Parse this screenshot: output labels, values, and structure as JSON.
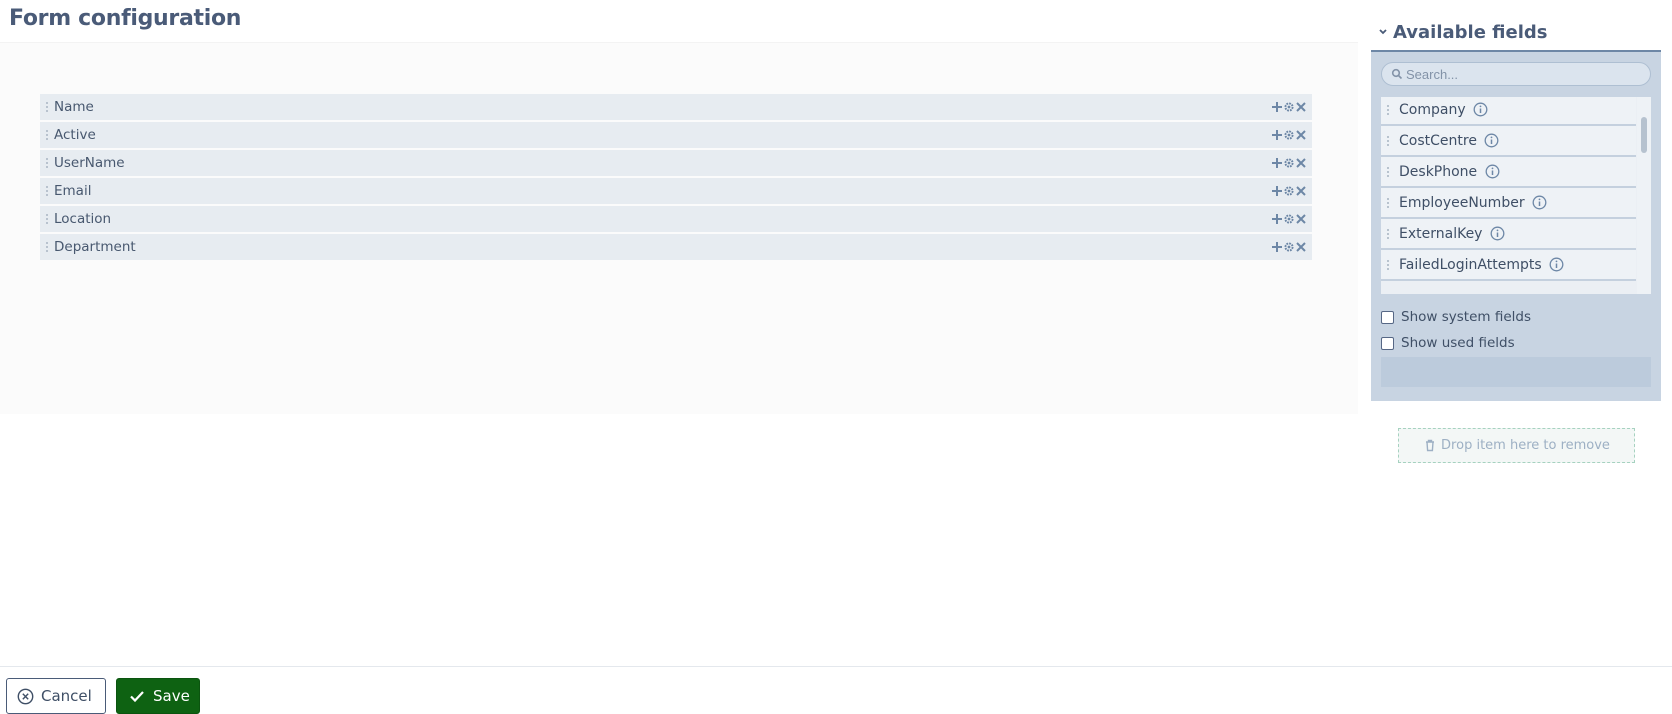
{
  "page": {
    "title": "Form configuration"
  },
  "form_fields": [
    {
      "label": "Name"
    },
    {
      "label": "Active"
    },
    {
      "label": "UserName"
    },
    {
      "label": "Email"
    },
    {
      "label": "Location"
    },
    {
      "label": "Department"
    }
  ],
  "available_panel": {
    "title": "Available fields",
    "search_placeholder": "Search...",
    "items": [
      {
        "label": "Company"
      },
      {
        "label": "CostCentre"
      },
      {
        "label": "DeskPhone"
      },
      {
        "label": "EmployeeNumber"
      },
      {
        "label": "ExternalKey"
      },
      {
        "label": "FailedLoginAttempts"
      }
    ],
    "show_system_fields_label": "Show system fields",
    "show_used_fields_label": "Show used fields"
  },
  "dropzone": {
    "label": "Drop item here to remove"
  },
  "footer": {
    "cancel_label": "Cancel",
    "save_label": "Save"
  },
  "colors": {
    "save_green": "#0e6212",
    "panel_bg": "#c8d4e2",
    "row_bg": "#e7ecf1",
    "title": "#4a5b78"
  },
  "icons": [
    "plus-icon",
    "gear-icon",
    "close-icon",
    "drag-handle-icon",
    "info-icon",
    "search-icon",
    "chevron-down-icon",
    "trash-icon",
    "cancel-circle-icon",
    "check-icon"
  ]
}
